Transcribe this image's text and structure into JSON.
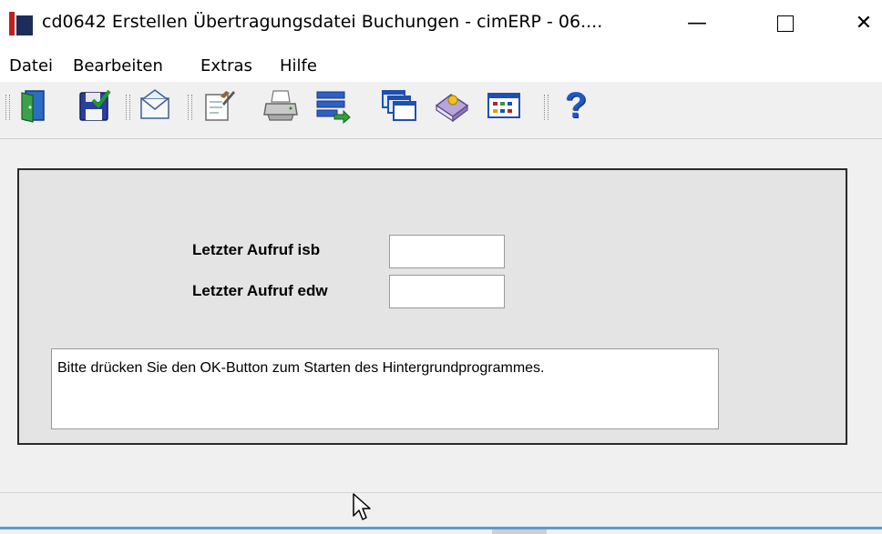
{
  "window": {
    "title": "cd0642 Erstellen Übertragungsdatei Buchungen - cimERP - 06....",
    "minimize_symbol": "—",
    "close_symbol": "✕"
  },
  "menu": [
    {
      "label": "Datei"
    },
    {
      "label": "Bearbeiten"
    },
    {
      "label": "Extras"
    },
    {
      "label": "Hilfe"
    }
  ],
  "toolbar": {
    "buttons": [
      {
        "icon": "exit-door-icon"
      },
      {
        "icon": "save-check-icon"
      },
      {
        "icon": "envelope-icon"
      },
      {
        "icon": "edit-document-icon"
      },
      {
        "icon": "printer-icon"
      },
      {
        "icon": "transfer-list-icon"
      },
      {
        "icon": "windows-cascade-icon"
      },
      {
        "icon": "book-icon"
      },
      {
        "icon": "grid-table-icon"
      },
      {
        "icon": "help-icon"
      }
    ],
    "help_glyph": "?"
  },
  "form": {
    "fields": [
      {
        "label": "Letzter Aufruf isb",
        "value": ""
      },
      {
        "label": "Letzter Aufruf edw",
        "value": ""
      }
    ],
    "message": "Bitte drücken Sie den OK-Button zum Starten des Hintergrundprogrammes."
  },
  "colors": {
    "accent": "#5b9bd5",
    "icon_red": "#c0201e",
    "icon_navy": "#1c2d5a",
    "help_blue": "#1f57c8"
  }
}
